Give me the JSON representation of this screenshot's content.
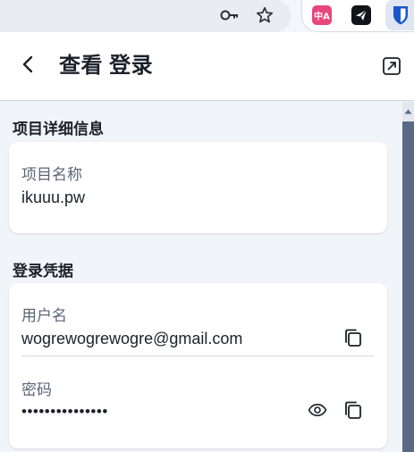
{
  "page": {
    "title": "查看 登录"
  },
  "sections": {
    "item_details": {
      "title": "项目详细信息",
      "name_label": "项目名称",
      "name_value": "ikuuu.pw"
    },
    "credentials": {
      "title": "登录凭据",
      "username_label": "用户名",
      "username_value": "wogrewogrewogre@gmail.com",
      "password_label": "密码",
      "password_value": "•••••••••••••••"
    }
  },
  "extensions": {
    "translate_badge": "中A"
  },
  "colors": {
    "accent_blue": "#1a56c9",
    "scrollbar_thumb": "#5a6a86",
    "translate_pink": "#e8467c"
  },
  "icons": [
    "key-icon",
    "star-icon",
    "translate-extension-icon",
    "send-extension-icon",
    "bitwarden-shield-icon",
    "back-arrow-icon",
    "popout-icon",
    "copy-icon",
    "eye-icon",
    "scroll-up-arrow-icon"
  ]
}
